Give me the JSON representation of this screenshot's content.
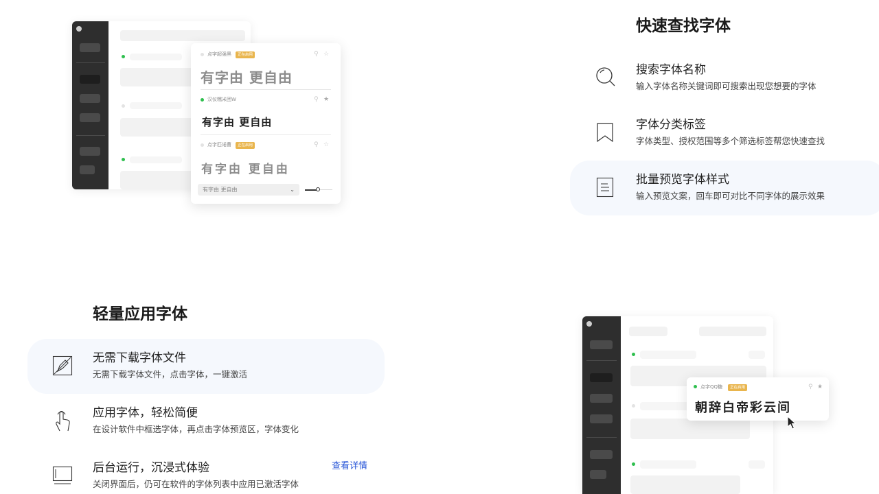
{
  "section1": {
    "title": "快速查找字体",
    "features": [
      {
        "icon": "search-icon",
        "title": "搜索字体名称",
        "desc": "输入字体名称关键词即可搜索出现您想要的字体",
        "active": false
      },
      {
        "icon": "bookmark-icon",
        "title": "字体分类标签",
        "desc": "字体类型、授权范围等多个筛选标签帮您快速查找",
        "active": false
      },
      {
        "icon": "document-icon",
        "title": "批量预览字体样式",
        "desc": "输入预览文案，回车即可对比不同字体的展示效果",
        "active": true
      }
    ]
  },
  "mockup1": {
    "fonts": [
      {
        "name": "点字超强黑",
        "tag": "正在启用",
        "sample": "有字由  更自由"
      },
      {
        "name": "汉仪糯米团W",
        "tag": "",
        "sample": "有字由 更自由"
      },
      {
        "name": "点字匹诺曹",
        "tag": "正在启用",
        "sample": "有字由  更自由"
      }
    ],
    "preview_input": "有字由  更自由"
  },
  "section2": {
    "title": "轻量应用字体",
    "features": [
      {
        "icon": "pen-icon",
        "title": "无需下载字体文件",
        "desc": "无需下载字体文件，点击字体，一键激活",
        "active": true
      },
      {
        "icon": "tap-hand-icon",
        "title": "应用字体，轻松简便",
        "desc": "在设计软件中框选字体，再点击字体预览区，字体变化",
        "active": false
      },
      {
        "icon": "monitor-icon",
        "title": "后台运行，沉浸式体验",
        "desc": "关闭界面后，仍可在软件的字体列表中应用已激活字体",
        "active": false
      }
    ],
    "link": "查看详情"
  },
  "mockup2": {
    "font_name": "点字QQ糖",
    "tag": "正在启用",
    "sample": "朝辞白帝彩云间"
  },
  "colors": {
    "accent": "#2b58d8",
    "active_bg": "#f5f8fd",
    "sidebar": "#2e2e2e",
    "tag": "#e9b54d",
    "green": "#2fbf4f"
  }
}
